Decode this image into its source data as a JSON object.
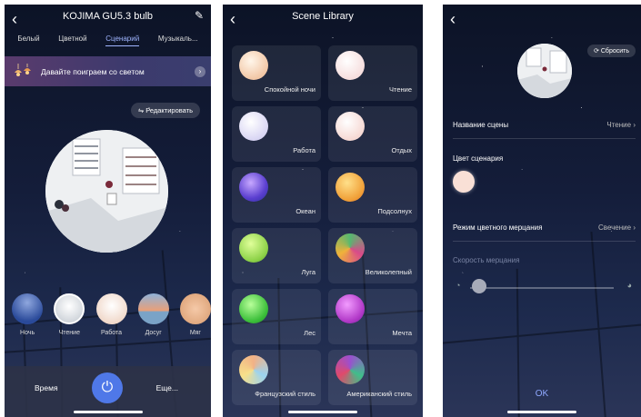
{
  "colors": {
    "accent": "#4f78e8",
    "tab_active": "#9fb4ff"
  },
  "screen1": {
    "back_icon": "chevron-left-icon",
    "title": "KOJIMA GU5.3 bulb",
    "edit_icon": "pencil-icon",
    "tabs": [
      "Белый",
      "Цветной",
      "Сценарий",
      "Музыкаль..."
    ],
    "active_tab": "Сценарий",
    "banner_text": "Давайте поиграем со светом",
    "edit_button": "Редактировать",
    "scenes": [
      {
        "label": "Ночь",
        "color": "#2a4a9a"
      },
      {
        "label": "Чтение",
        "color": "#e7e8ec"
      },
      {
        "label": "Работа",
        "color": "#f0d7c8"
      },
      {
        "label": "Досуг",
        "color": "#e8a07a"
      },
      {
        "label": "Мяг",
        "color": "#d89b6e"
      }
    ],
    "bottom_left": "Время",
    "bottom_right": "Еще...",
    "power_icon": "power-icon"
  },
  "screen2": {
    "back_icon": "chevron-left-icon",
    "title": "Scene Library",
    "cards": [
      {
        "label": "Спокойной ночи",
        "color": "#f2c7a6"
      },
      {
        "label": "Чтение",
        "color": "#f6dede"
      },
      {
        "label": "Работа",
        "color": "#d9d6f4"
      },
      {
        "label": "Отдых",
        "color": "#f6d9d4"
      },
      {
        "label": "Океан",
        "color": "#5b3fd0"
      },
      {
        "label": "Подсолнух",
        "color": "#f1a23a"
      },
      {
        "label": "Луга",
        "color": "#8fd34a"
      },
      {
        "label": "Великолепный",
        "color": "#56b86f"
      },
      {
        "label": "Лес",
        "color": "#3cbf3a"
      },
      {
        "label": "Мечта",
        "color": "#b239c8"
      },
      {
        "label": "Французский стиль",
        "color": "#f2b186"
      },
      {
        "label": "Американский стиль",
        "color": "#9b4fcf"
      }
    ]
  },
  "screen3": {
    "back_icon": "chevron-left-icon",
    "reset_button": "Сбросить",
    "scene_name_label": "Название сцены",
    "scene_name_value": "Чтение",
    "scene_color_label": "Цвет сценария",
    "mode_label": "Режим цветного мерцания",
    "mode_value": "Свечение",
    "speed_label": "Скорость мерцания",
    "speed_level": 0.05,
    "ok_button": "OK"
  }
}
